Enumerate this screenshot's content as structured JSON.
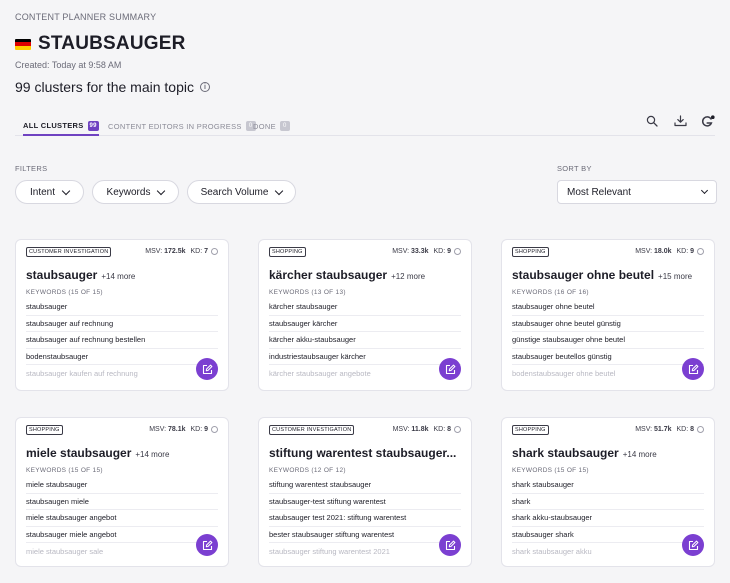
{
  "header": {
    "small_title": "CONTENT PLANNER SUMMARY",
    "title": "STAUBSAUGER",
    "flag_colors": [
      "#000000",
      "#dd0000",
      "#ffce00"
    ],
    "created": "Created: Today at 9:58 AM",
    "clusters_text": "99 clusters for the main topic"
  },
  "tabs": [
    {
      "label": "ALL CLUSTERS",
      "count": "99"
    },
    {
      "label": "CONTENT EDITORS IN PROGRESS",
      "count": "0"
    },
    {
      "label": "DONE",
      "count": "0"
    }
  ],
  "tools": [
    "search-icon",
    "download-icon",
    "google-icon"
  ],
  "filters": {
    "label": "FILTERS",
    "buttons": [
      "Intent",
      "Keywords",
      "Search Volume"
    ]
  },
  "sort": {
    "label": "SORT BY",
    "selected": "Most Relevant"
  },
  "colors": {
    "accent": "#7b3fd1",
    "google_dot": "#7b3fd1"
  },
  "cards": [
    {
      "badge": "CUSTOMER INVESTIGATION",
      "msv": "172.5k",
      "kd": "7",
      "title": "staubsauger",
      "more": "+14 more",
      "keywords_label": "KEYWORDS (15 OF 15)",
      "keywords": [
        "staubsauger",
        "staubsauger auf rechnung",
        "staubsauger auf rechnung bestellen",
        "bodenstaubsauger",
        "staubsauger kaufen auf rechnung"
      ]
    },
    {
      "badge": "SHOPPING",
      "msv": "33.3k",
      "kd": "9",
      "title": "kärcher staubsauger",
      "more": "+12 more",
      "keywords_label": "KEYWORDS (13 OF 13)",
      "keywords": [
        "kärcher staubsauger",
        "staubsauger kärcher",
        "kärcher akku-staubsauger",
        "industriestaubsauger kärcher",
        "kärcher staubsauger angebote"
      ]
    },
    {
      "badge": "SHOPPING",
      "msv": "18.0k",
      "kd": "9",
      "title": "staubsauger ohne beutel",
      "more": "+15 more",
      "keywords_label": "KEYWORDS (16 OF 16)",
      "keywords": [
        "staubsauger ohne beutel",
        "staubsauger ohne beutel günstig",
        "günstige staubsauger ohne beutel",
        "staubsauger beutellos günstig",
        "bodenstaubsauger ohne beutel"
      ]
    },
    {
      "badge": "SHOPPING",
      "msv": "78.1k",
      "kd": "9",
      "title": "miele staubsauger",
      "more": "+14 more",
      "keywords_label": "KEYWORDS (15 OF 15)",
      "keywords": [
        "miele staubsauger",
        "staubsaugen miele",
        "miele staubsauger angebot",
        "staubsauger miele angebot",
        "miele staubsauger sale"
      ]
    },
    {
      "badge": "CUSTOMER INVESTIGATION",
      "msv": "11.8k",
      "kd": "8",
      "title": "stiftung warentest staubsauger...",
      "more": "",
      "keywords_label": "KEYWORDS (12 OF 12)",
      "keywords": [
        "stiftung warentest staubsauger",
        "staubsauger-test stiftung warentest",
        "staubsauger test 2021: stiftung warentest",
        "bester staubsauger stiftung warentest",
        "staubsauger stiftung warentest 2021"
      ]
    },
    {
      "badge": "SHOPPING",
      "msv": "51.7k",
      "kd": "8",
      "title": "shark staubsauger",
      "more": "+14 more",
      "keywords_label": "KEYWORDS (15 OF 15)",
      "keywords": [
        "shark staubsauger",
        "shark",
        "shark akku-staubsauger",
        "staubsauger shark",
        "shark staubsauger akku"
      ]
    }
  ]
}
